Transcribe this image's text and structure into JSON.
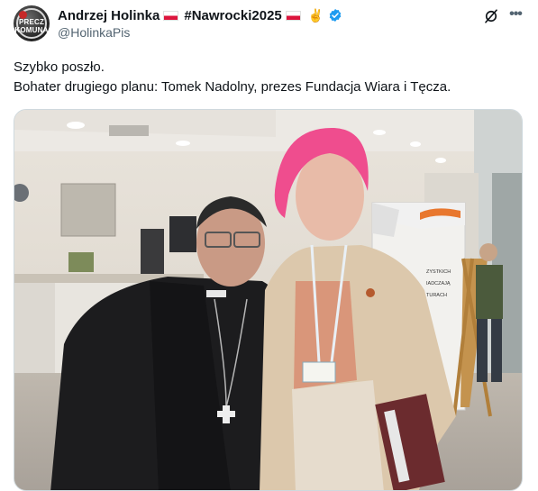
{
  "author": {
    "display_name": "Andrzej Holinka",
    "hashtag": "#Nawrocki2025",
    "victory_emoji": "✌",
    "handle": "@HolinkaPis",
    "avatar_text": [
      "PRECZ",
      "KOMUNĄ"
    ]
  },
  "tweet": {
    "lines": [
      "Szybko poszło.",
      "Bohater drugiego planu: Tomek Nadolny, prezes Fundacja Wiara i Tęcza."
    ]
  },
  "media": {
    "sign_text": [
      "ZYSTKICH",
      "IADCZAJĄ",
      "TURACH"
    ]
  },
  "icons": {
    "verified": "verified-badge-icon",
    "grok": "grok-icon",
    "more": "more-icon",
    "flag": "poland-flag-icon"
  },
  "colors": {
    "verified": "#1d9bf0",
    "text": "#0f1419",
    "secondary": "#536471"
  }
}
